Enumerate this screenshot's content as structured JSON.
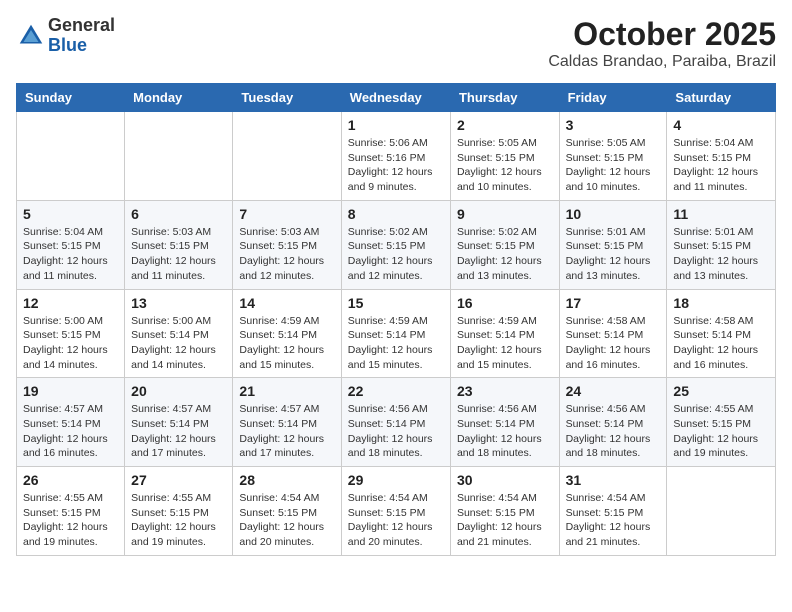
{
  "logo": {
    "general": "General",
    "blue": "Blue"
  },
  "header": {
    "month": "October 2025",
    "location": "Caldas Brandao, Paraiba, Brazil"
  },
  "weekdays": [
    "Sunday",
    "Monday",
    "Tuesday",
    "Wednesday",
    "Thursday",
    "Friday",
    "Saturday"
  ],
  "weeks": [
    [
      null,
      null,
      null,
      {
        "day": "1",
        "sunrise": "Sunrise: 5:06 AM",
        "sunset": "Sunset: 5:16 PM",
        "daylight": "Daylight: 12 hours and 9 minutes."
      },
      {
        "day": "2",
        "sunrise": "Sunrise: 5:05 AM",
        "sunset": "Sunset: 5:15 PM",
        "daylight": "Daylight: 12 hours and 10 minutes."
      },
      {
        "day": "3",
        "sunrise": "Sunrise: 5:05 AM",
        "sunset": "Sunset: 5:15 PM",
        "daylight": "Daylight: 12 hours and 10 minutes."
      },
      {
        "day": "4",
        "sunrise": "Sunrise: 5:04 AM",
        "sunset": "Sunset: 5:15 PM",
        "daylight": "Daylight: 12 hours and 11 minutes."
      }
    ],
    [
      {
        "day": "5",
        "sunrise": "Sunrise: 5:04 AM",
        "sunset": "Sunset: 5:15 PM",
        "daylight": "Daylight: 12 hours and 11 minutes."
      },
      {
        "day": "6",
        "sunrise": "Sunrise: 5:03 AM",
        "sunset": "Sunset: 5:15 PM",
        "daylight": "Daylight: 12 hours and 11 minutes."
      },
      {
        "day": "7",
        "sunrise": "Sunrise: 5:03 AM",
        "sunset": "Sunset: 5:15 PM",
        "daylight": "Daylight: 12 hours and 12 minutes."
      },
      {
        "day": "8",
        "sunrise": "Sunrise: 5:02 AM",
        "sunset": "Sunset: 5:15 PM",
        "daylight": "Daylight: 12 hours and 12 minutes."
      },
      {
        "day": "9",
        "sunrise": "Sunrise: 5:02 AM",
        "sunset": "Sunset: 5:15 PM",
        "daylight": "Daylight: 12 hours and 13 minutes."
      },
      {
        "day": "10",
        "sunrise": "Sunrise: 5:01 AM",
        "sunset": "Sunset: 5:15 PM",
        "daylight": "Daylight: 12 hours and 13 minutes."
      },
      {
        "day": "11",
        "sunrise": "Sunrise: 5:01 AM",
        "sunset": "Sunset: 5:15 PM",
        "daylight": "Daylight: 12 hours and 13 minutes."
      }
    ],
    [
      {
        "day": "12",
        "sunrise": "Sunrise: 5:00 AM",
        "sunset": "Sunset: 5:15 PM",
        "daylight": "Daylight: 12 hours and 14 minutes."
      },
      {
        "day": "13",
        "sunrise": "Sunrise: 5:00 AM",
        "sunset": "Sunset: 5:14 PM",
        "daylight": "Daylight: 12 hours and 14 minutes."
      },
      {
        "day": "14",
        "sunrise": "Sunrise: 4:59 AM",
        "sunset": "Sunset: 5:14 PM",
        "daylight": "Daylight: 12 hours and 15 minutes."
      },
      {
        "day": "15",
        "sunrise": "Sunrise: 4:59 AM",
        "sunset": "Sunset: 5:14 PM",
        "daylight": "Daylight: 12 hours and 15 minutes."
      },
      {
        "day": "16",
        "sunrise": "Sunrise: 4:59 AM",
        "sunset": "Sunset: 5:14 PM",
        "daylight": "Daylight: 12 hours and 15 minutes."
      },
      {
        "day": "17",
        "sunrise": "Sunrise: 4:58 AM",
        "sunset": "Sunset: 5:14 PM",
        "daylight": "Daylight: 12 hours and 16 minutes."
      },
      {
        "day": "18",
        "sunrise": "Sunrise: 4:58 AM",
        "sunset": "Sunset: 5:14 PM",
        "daylight": "Daylight: 12 hours and 16 minutes."
      }
    ],
    [
      {
        "day": "19",
        "sunrise": "Sunrise: 4:57 AM",
        "sunset": "Sunset: 5:14 PM",
        "daylight": "Daylight: 12 hours and 16 minutes."
      },
      {
        "day": "20",
        "sunrise": "Sunrise: 4:57 AM",
        "sunset": "Sunset: 5:14 PM",
        "daylight": "Daylight: 12 hours and 17 minutes."
      },
      {
        "day": "21",
        "sunrise": "Sunrise: 4:57 AM",
        "sunset": "Sunset: 5:14 PM",
        "daylight": "Daylight: 12 hours and 17 minutes."
      },
      {
        "day": "22",
        "sunrise": "Sunrise: 4:56 AM",
        "sunset": "Sunset: 5:14 PM",
        "daylight": "Daylight: 12 hours and 18 minutes."
      },
      {
        "day": "23",
        "sunrise": "Sunrise: 4:56 AM",
        "sunset": "Sunset: 5:14 PM",
        "daylight": "Daylight: 12 hours and 18 minutes."
      },
      {
        "day": "24",
        "sunrise": "Sunrise: 4:56 AM",
        "sunset": "Sunset: 5:14 PM",
        "daylight": "Daylight: 12 hours and 18 minutes."
      },
      {
        "day": "25",
        "sunrise": "Sunrise: 4:55 AM",
        "sunset": "Sunset: 5:15 PM",
        "daylight": "Daylight: 12 hours and 19 minutes."
      }
    ],
    [
      {
        "day": "26",
        "sunrise": "Sunrise: 4:55 AM",
        "sunset": "Sunset: 5:15 PM",
        "daylight": "Daylight: 12 hours and 19 minutes."
      },
      {
        "day": "27",
        "sunrise": "Sunrise: 4:55 AM",
        "sunset": "Sunset: 5:15 PM",
        "daylight": "Daylight: 12 hours and 19 minutes."
      },
      {
        "day": "28",
        "sunrise": "Sunrise: 4:54 AM",
        "sunset": "Sunset: 5:15 PM",
        "daylight": "Daylight: 12 hours and 20 minutes."
      },
      {
        "day": "29",
        "sunrise": "Sunrise: 4:54 AM",
        "sunset": "Sunset: 5:15 PM",
        "daylight": "Daylight: 12 hours and 20 minutes."
      },
      {
        "day": "30",
        "sunrise": "Sunrise: 4:54 AM",
        "sunset": "Sunset: 5:15 PM",
        "daylight": "Daylight: 12 hours and 21 minutes."
      },
      {
        "day": "31",
        "sunrise": "Sunrise: 4:54 AM",
        "sunset": "Sunset: 5:15 PM",
        "daylight": "Daylight: 12 hours and 21 minutes."
      },
      null
    ]
  ]
}
